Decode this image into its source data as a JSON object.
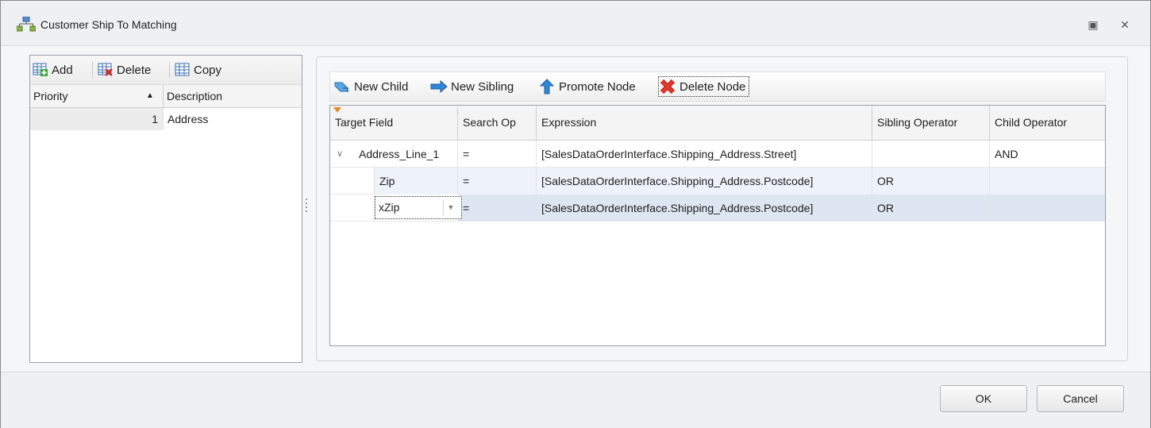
{
  "window": {
    "title": "Customer Ship To Matching",
    "restore_glyph": "▣",
    "close_glyph": "✕",
    "icon": "sitemap-icon"
  },
  "left_panel": {
    "toolbar": {
      "add_label": "Add",
      "delete_label": "Delete",
      "copy_label": "Copy"
    },
    "columns": {
      "priority": "Priority",
      "description": "Description",
      "sort_glyph": "▲"
    },
    "rows": [
      {
        "priority": "1",
        "description": "Address"
      }
    ]
  },
  "right_panel": {
    "toolbar": {
      "new_child": "New Child",
      "new_sibling": "New Sibling",
      "promote_node": "Promote Node",
      "delete_node": "Delete Node"
    },
    "columns": {
      "target_field": "Target Field",
      "search_op": "Search Op",
      "expression": "Expression",
      "sibling_operator": "Sibling Operator",
      "child_operator": "Child Operator"
    },
    "rows": [
      {
        "target_field": "Address_Line_1",
        "search_op": "=",
        "expression": "[SalesDataOrderInterface.Shipping_Address.Street]",
        "sibling_operator": "",
        "child_operator": "AND",
        "expanded": true
      },
      {
        "target_field": "Zip",
        "search_op": "=",
        "expression": "[SalesDataOrderInterface.Shipping_Address.Postcode]",
        "sibling_operator": "OR",
        "child_operator": ""
      },
      {
        "target_field": "xZip",
        "search_op": "=",
        "expression": "[SalesDataOrderInterface.Shipping_Address.Postcode]",
        "sibling_operator": "OR",
        "child_operator": "",
        "editing": true
      }
    ]
  },
  "footer": {
    "ok_label": "OK",
    "cancel_label": "Cancel"
  },
  "colors": {
    "selected_row": "#dde6f1",
    "alt_row": "#eef3fa",
    "left_selected": "#ececec",
    "delete_red": "#d62b1f",
    "sibling_arrow": "#2e86d6"
  }
}
